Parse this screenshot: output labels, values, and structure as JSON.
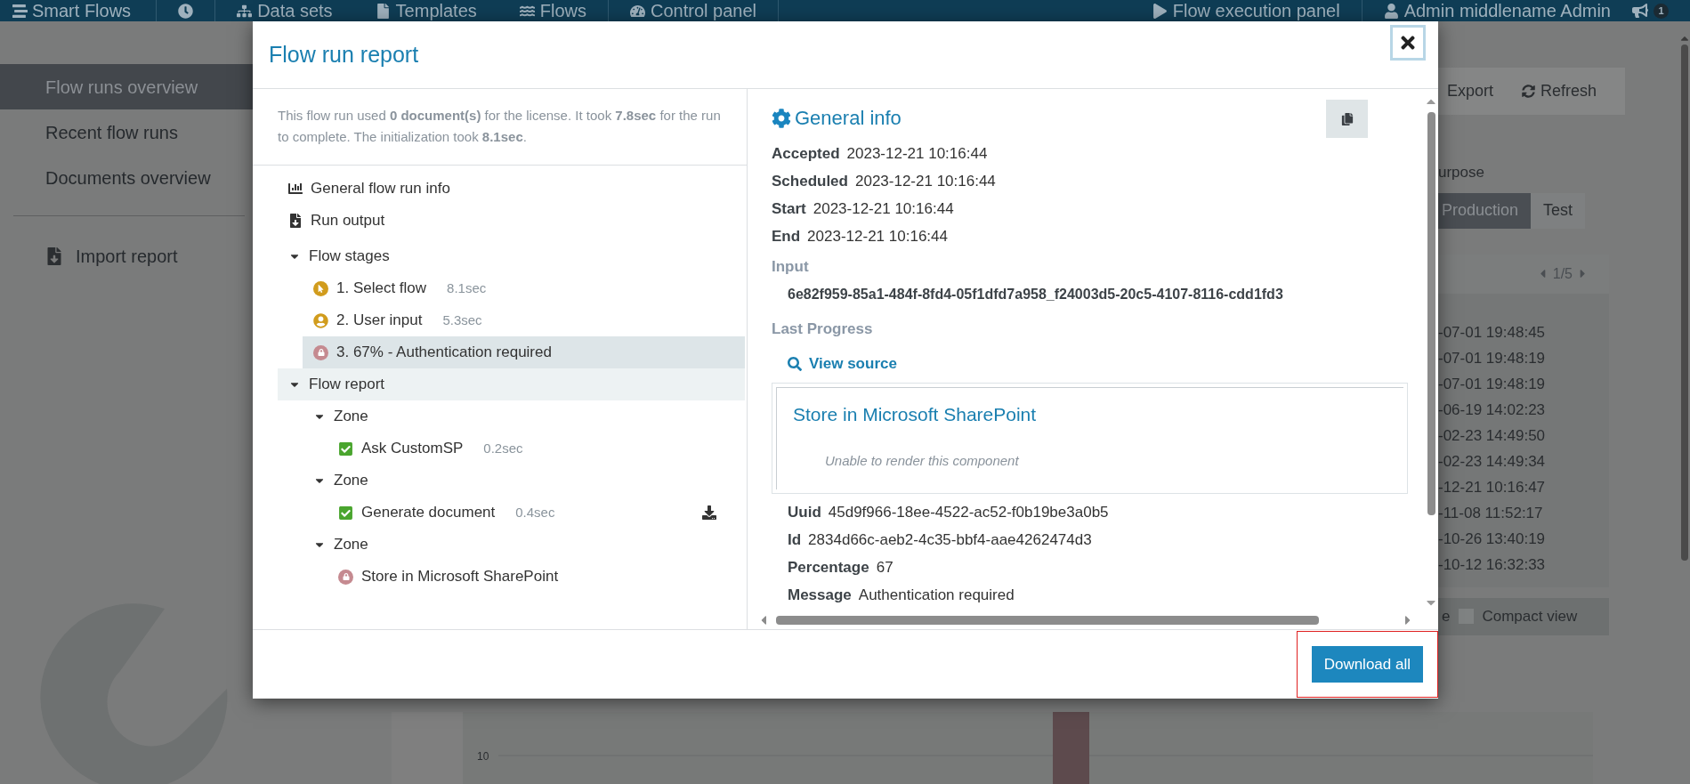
{
  "top_bar": {
    "brand": "Smart Flows",
    "items": [
      {
        "kind": "clock"
      },
      {
        "kind": "sitemap",
        "label": "Data sets"
      },
      {
        "kind": "file",
        "label": "Templates"
      },
      {
        "kind": "waves",
        "label": "Flows"
      },
      {
        "kind": "gauge",
        "label": "Control panel"
      },
      {
        "kind": "play",
        "label": "Flow execution panel"
      },
      {
        "kind": "user",
        "label": "Admin middlename Admin"
      }
    ],
    "notification_count": "1"
  },
  "sidebar": {
    "items": [
      {
        "label": "Flow runs overview",
        "selected": true
      },
      {
        "label": "Recent flow runs",
        "selected": false
      },
      {
        "label": "Documents overview",
        "selected": false
      }
    ],
    "import_label": "Import report"
  },
  "background": {
    "toolbar": [
      "Export",
      "Refresh"
    ],
    "purpose_label": "urpose",
    "purpose_options": [
      {
        "label": "Production",
        "selected": true
      },
      {
        "label": "Test",
        "selected": false
      }
    ],
    "pager": "1/5",
    "dates": [
      "-07-01 19:48:45",
      "-07-01 19:48:19",
      "-07-01 19:48:19",
      "-06-19 14:02:23",
      "-02-23 14:49:50",
      "-02-23 14:49:34",
      "-12-21 10:16:47",
      "-11-08 11:52:17",
      "-10-26 13:40:19",
      "-10-12 16:32:33"
    ],
    "view_options": [
      {
        "label": "e",
        "kind": "text"
      },
      {
        "label": "Compact view",
        "kind": "checkbox",
        "checked": false
      }
    ],
    "chart_tick": "10"
  },
  "modal": {
    "title": "Flow run report",
    "summary": "This flow run used **0 document(s)** for the license. It took **7.8sec** for the run to complete. The initialization took **8.1sec**.",
    "nav": [
      {
        "kind": "chart",
        "label": "General flow run info"
      },
      {
        "kind": "output",
        "label": "Run output"
      }
    ],
    "tree": [
      {
        "label": "Flow stages",
        "expanded": true,
        "selected": false,
        "hovered": false,
        "children": [
          {
            "label": "1. Select flow",
            "time": "8.1sec",
            "kind": "select",
            "selected": false,
            "hovered": false
          },
          {
            "label": "2. User input",
            "time": "5.3sec",
            "kind": "user",
            "selected": false,
            "hovered": false
          },
          {
            "label": "3. 67% - Authentication required",
            "kind": "locked",
            "selected": true
          }
        ]
      },
      {
        "label": "Flow report",
        "expanded": true,
        "selected": false,
        "hovered": true,
        "children": [
          {
            "label": "Zone",
            "expanded": true,
            "selected": false,
            "hovered": false,
            "children": [
              {
                "label": "Ask CustomSP",
                "time": "0.2sec",
                "kind": "done",
                "selected": false,
                "hovered": false
              }
            ]
          },
          {
            "label": "Zone",
            "expanded": true,
            "selected": false,
            "hovered": false,
            "children": [
              {
                "label": "Generate document",
                "time": "0.4sec",
                "kind": "done",
                "downloadable": true,
                "selected": false,
                "hovered": false
              }
            ]
          },
          {
            "label": "Zone",
            "expanded": true,
            "selected": false,
            "hovered": false,
            "children": [
              {
                "label": "Store in Microsoft SharePoint",
                "kind": "locked",
                "selected": false,
                "hovered": false
              }
            ]
          }
        ]
      }
    ],
    "info_title": "General info",
    "fields": [
      {
        "label": "Accepted",
        "value": "2023-12-21 10:16:44"
      },
      {
        "label": "Scheduled",
        "value": "2023-12-21 10:16:44"
      },
      {
        "label": "Start",
        "value": "2023-12-21 10:16:44"
      },
      {
        "label": "End",
        "value": "2023-12-21 10:16:44"
      }
    ],
    "input_label": "Input",
    "input_value": "6e82f959-85a1-484f-8fd4-05f1dfd7a958_f24003d5-20c5-4107-8116-cdd1fd3",
    "progress_label": "Last Progress",
    "view_source": "View source",
    "component": {
      "title": "Store in Microsoft SharePoint",
      "message": "Unable to render this component"
    },
    "progress_fields": [
      {
        "label": "Uuid",
        "value": "45d9f966-18ee-4522-ac52-f0b19be3a0b5"
      },
      {
        "label": "Id",
        "value": "2834d66c-aeb2-4c35-bbf4-aae4262474d3"
      },
      {
        "label": "Percentage",
        "value": "67"
      },
      {
        "label": "Message",
        "value": "Authentication required"
      }
    ],
    "download_button": {
      "label": "Download all",
      "highlighted": true
    }
  }
}
